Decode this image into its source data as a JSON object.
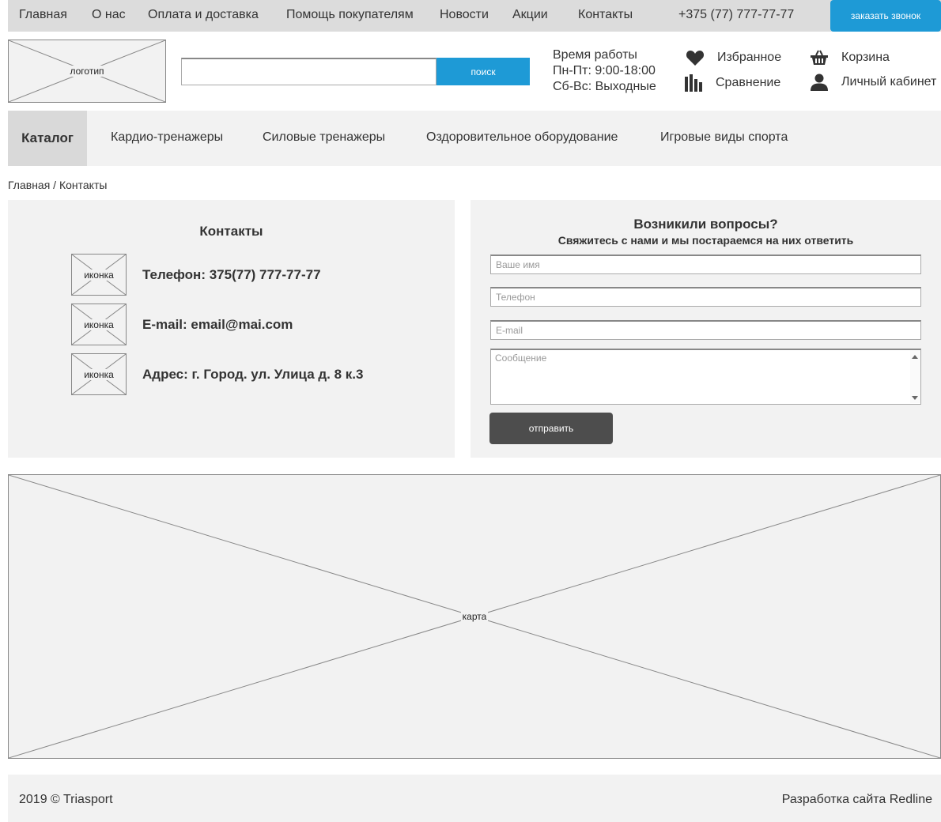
{
  "topnav": {
    "items": [
      "Главная",
      "О нас",
      "Оплата и доставка",
      "Помощь покупателям",
      "Новости",
      "Акции",
      "Контакты"
    ],
    "phone": "+375 (77) 777-77-77",
    "callback_label": "заказать звонок"
  },
  "header": {
    "logo_label": "логотип",
    "search_placeholder": "",
    "search_button": "поиск",
    "hours_title": "Время работы",
    "hours_weekdays": "Пн-Пт: 9:00-18:00",
    "hours_weekend": "Сб-Вс: Выходные",
    "favorites": "Избранное",
    "compare": "Сравнение",
    "cart": "Корзина",
    "account": "Личный кабинет"
  },
  "catalog": {
    "main_label": "Каталог",
    "items": [
      "Кардио-тренажеры",
      "Силовые тренажеры",
      "Оздоровительное оборудование",
      "Игровые виды спорта"
    ]
  },
  "breadcrumb": {
    "home": "Главная",
    "separator": " / ",
    "current": "Контакты"
  },
  "contacts": {
    "title": "Контакты",
    "icon_label": "иконка",
    "phone": "Телефон: 375(77) 777-77-77",
    "email": "E-mail: email@mai.com",
    "address": "Адрес: г. Город. ул. Улица д. 8 к.3"
  },
  "form": {
    "title": "Возникили вопросы?",
    "subtitle": "Свяжитесь с нами и мы постараемся на них ответить",
    "name_placeholder": "Ваше имя",
    "phone_placeholder": "Телефон",
    "email_placeholder": "E-mail",
    "message_placeholder": "Сообщение",
    "submit_label": "отправить"
  },
  "map": {
    "label": "карта"
  },
  "footer": {
    "copyright": "2019 © Triasport",
    "developer": "Разработка сайта Redline"
  },
  "colors": {
    "accent": "#1e9ad6",
    "dark_button": "#4d4d4d",
    "panel_bg": "#f2f2f2",
    "topbar_bg": "#dcdcdc"
  }
}
